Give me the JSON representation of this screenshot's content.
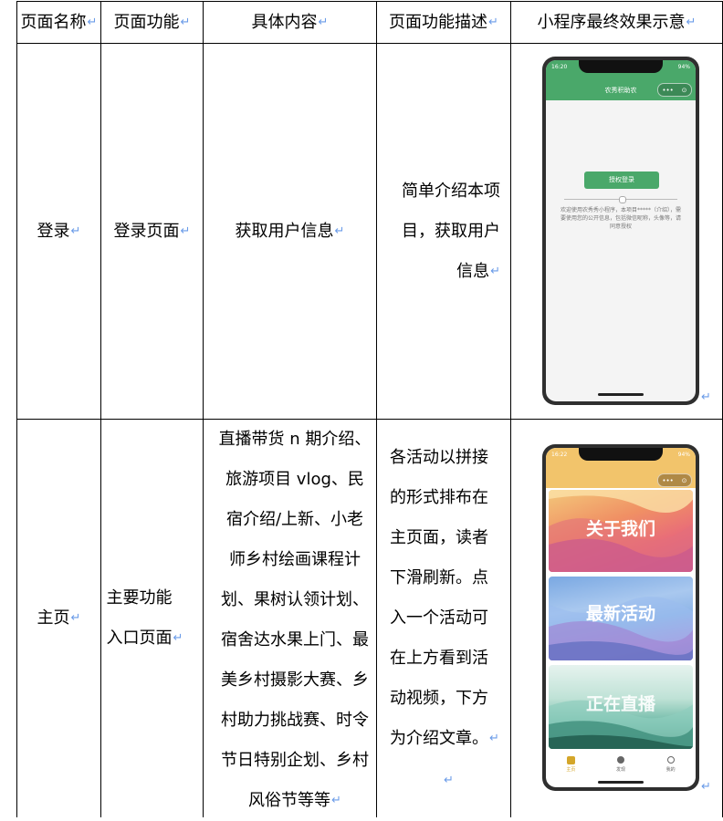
{
  "table": {
    "headers": [
      "页面名称",
      "页面功能",
      "具体内容",
      "页面功能描述",
      "小程序最终效果示意"
    ],
    "rows": [
      {
        "name": "登录",
        "function": "登录页面",
        "content": "获取用户信息",
        "description": "简单介绍本项\n目，获取用户\n信息"
      },
      {
        "name": "主页",
        "function": "主要功能\n入口页面",
        "content": "直播带货 n 期介绍、\n旅游项目 vlog、民\n宿介绍/上新、小老\n师乡村绘画课程计\n划、果树认领计划、\n宿舍达水果上门、最\n美乡村摄影大赛、乡\n村助力挑战赛、时令\n节日特别企划、乡村\n风俗节等等",
        "description": "各活动以拼接\n的形式排布在\n主页面，读者\n下滑刷新。点\n入一个活动可\n在上方看到活\n动视频，下方\n为介绍文章。"
      }
    ],
    "return_mark": "↵"
  },
  "login_phone": {
    "time": "16:20",
    "battery": "94%",
    "title": "农秀积助农",
    "capsule_dots": "•••",
    "capsule_target": "⊙",
    "button": "授权登录",
    "intro": "欢迎使用农秀秀小程序，本项目*****（介绍），需要使用您的公开信息，包括微信昵称，头像等，请同意授权",
    "colors": {
      "header": "#4aa86a",
      "button": "#4aa86a",
      "screen": "#f4f4f4"
    }
  },
  "home_phone": {
    "time": "16:22",
    "battery": "94%",
    "capsule_dots": "•••",
    "capsule_target": "⊙",
    "cards": [
      "关于我们",
      "最新活动",
      "正在直播"
    ],
    "tabs": [
      {
        "label": "主页",
        "icon": "home-icon"
      },
      {
        "label": "发现",
        "icon": "discover-icon"
      },
      {
        "label": "我的",
        "icon": "profile-icon"
      }
    ],
    "colors": {
      "header": "#f2c46b",
      "active_tab": "#d4a62a"
    }
  }
}
